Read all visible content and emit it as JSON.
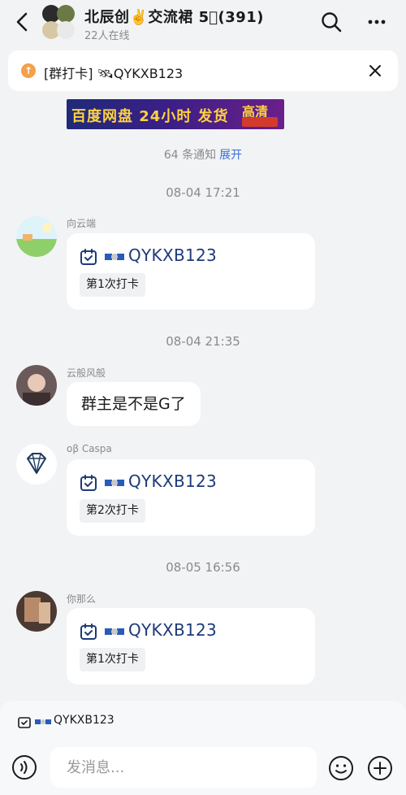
{
  "header": {
    "title": "北辰创✌️交流裙 5⃣️(391)",
    "online": "22人在线",
    "icons": {
      "back": "chevron-left-icon",
      "search": "search-icon",
      "more": "more-icon"
    }
  },
  "pinned": {
    "text": "[群打卡] 🛰QYKXB123",
    "icon": "announcement-icon",
    "close_icon": "close-icon"
  },
  "banner": {
    "text": "百度网盘 24小时 发货",
    "badge": "高清"
  },
  "notice": {
    "count_text": "64 条通知",
    "expand_label": "展开"
  },
  "timestamps": [
    "08-04 17:21",
    "08-04 21:35",
    "08-05 16:56"
  ],
  "messages": [
    {
      "sender": "向云端",
      "code": "QYKXB123",
      "checkin": "第1次打卡"
    },
    {
      "sender": "云般风般",
      "text": "群主是不是G了"
    },
    {
      "sender": "oβ Caspa",
      "code": "QYKXB123",
      "checkin": "第2次打卡"
    },
    {
      "sender": "你那么",
      "code": "QYKXB123",
      "checkin": "第1次打卡"
    }
  ],
  "composer": {
    "quick_pin": "QYKXB123",
    "placeholder": "发消息...",
    "icons": {
      "voice": "voice-icon",
      "emoji": "emoji-icon",
      "plus": "plus-icon"
    }
  },
  "colors": {
    "background": "#f2f3f5",
    "card": "#ffffff",
    "code_text": "#1e3a78",
    "link": "#3a6ed6",
    "muted": "#8a8a8a"
  }
}
